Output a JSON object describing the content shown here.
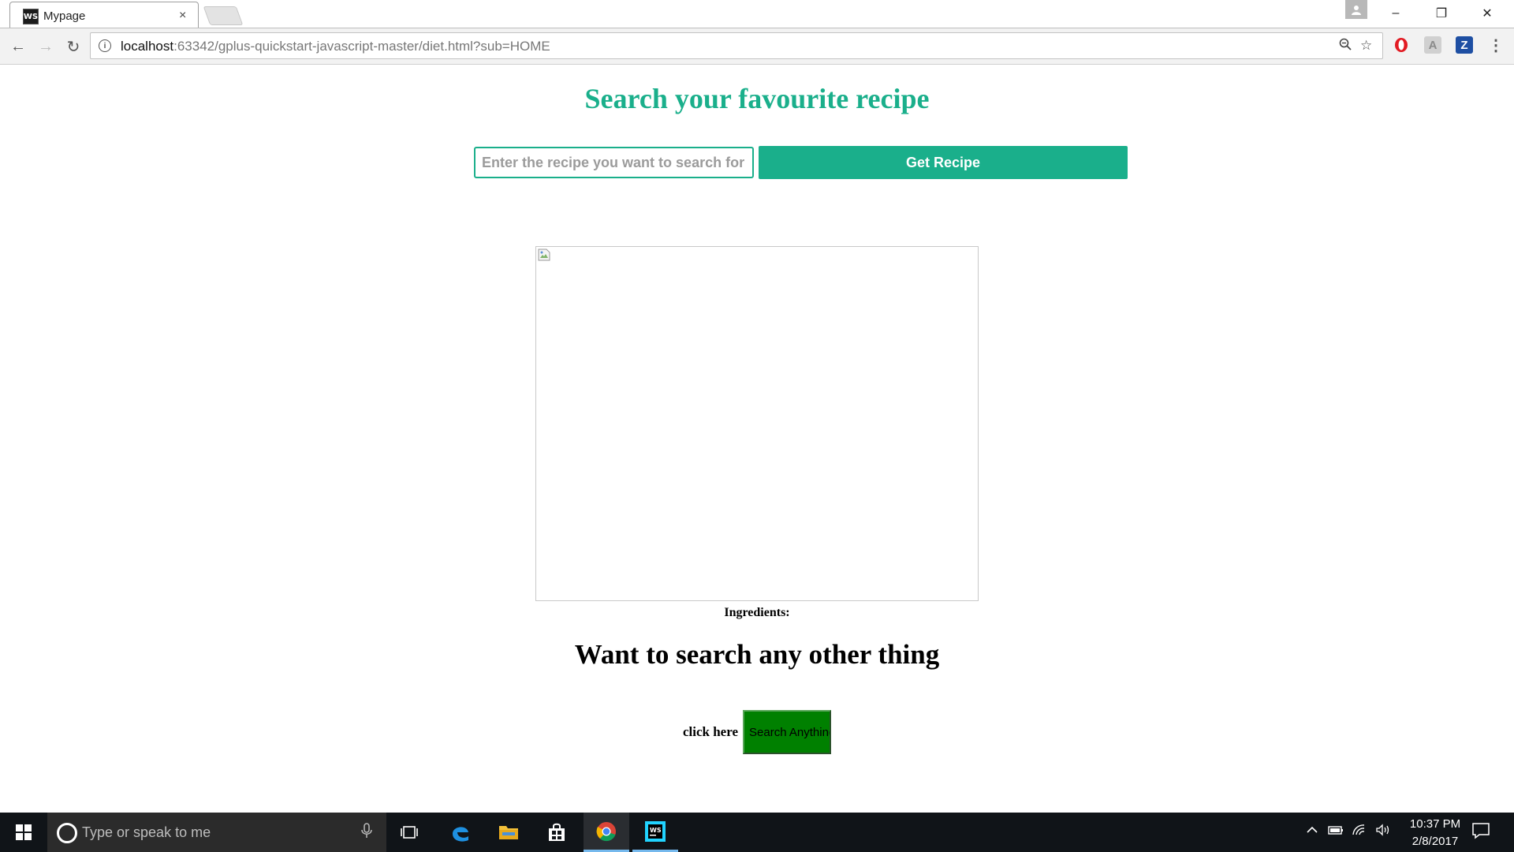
{
  "browser": {
    "tab": {
      "title": "Mypage",
      "favicon": "WS",
      "close": "×"
    },
    "window_controls": {
      "minimize": "–",
      "restore": "❐",
      "close": "✕"
    },
    "nav": {
      "back": "←",
      "forward": "→",
      "reload": "↻"
    },
    "address": {
      "host": "localhost",
      "rest": ":63342/gplus-quickstart-javascript-master/diet.html?sub=HOME"
    },
    "extensions": [
      "opera-icon",
      "acrobat-icon",
      "zotero-icon"
    ],
    "extension_labels": {
      "opera": "O",
      "acrobat": "A",
      "zotero": "Z"
    },
    "menu": "⋮"
  },
  "page": {
    "heading": "Search your favourite recipe",
    "search": {
      "placeholder": "Enter the recipe you want to search for",
      "value": ""
    },
    "get_recipe_label": "Get Recipe",
    "ingredients_label": "Ingredients:",
    "subheading": "Want to search any other thing",
    "click_label": "click here",
    "search_anything_label": "Search Anything"
  },
  "taskbar": {
    "search_placeholder": "Type or speak to me",
    "apps": [
      "task-view-icon",
      "edge-icon",
      "file-explorer-icon",
      "store-icon",
      "chrome-icon",
      "webstorm-icon"
    ],
    "clock": {
      "time": "10:37 PM",
      "date": "2/8/2017"
    }
  },
  "colors": {
    "accent": "#1aaf8b",
    "search_anything_bg": "#008000",
    "taskbar_bg": "#101418"
  }
}
